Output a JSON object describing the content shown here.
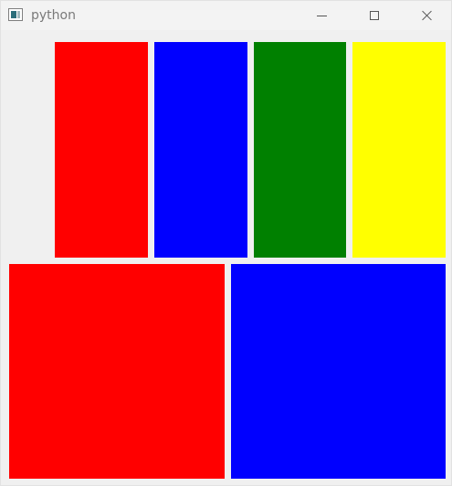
{
  "window": {
    "title": "python",
    "controls": {
      "minimize_icon": "minimize-icon",
      "maximize_icon": "maximize-icon",
      "close_icon": "close-icon"
    }
  },
  "content": {
    "top_row": [
      {
        "name": "red-panel-1",
        "color": "#ff0000"
      },
      {
        "name": "blue-panel-1",
        "color": "#0000ff"
      },
      {
        "name": "green-panel-1",
        "color": "#008000"
      },
      {
        "name": "yellow-panel-1",
        "color": "#ffff00"
      }
    ],
    "bottom_row": [
      {
        "name": "red-panel-2",
        "color": "#ff0000"
      },
      {
        "name": "blue-panel-2",
        "color": "#0000ff"
      }
    ]
  }
}
